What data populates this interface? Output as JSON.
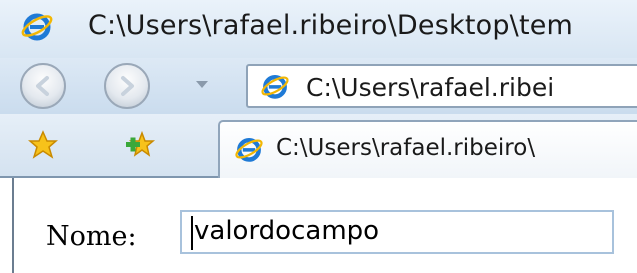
{
  "window": {
    "title": "C:\\Users\\rafael.ribeiro\\Desktop\\tem"
  },
  "navbar": {
    "address": "C:\\Users\\rafael.ribei"
  },
  "tabbar": {
    "tab_title": "C:\\Users\\rafael.ribeiro\\"
  },
  "form": {
    "label": "Nome:",
    "value": "valordocampo"
  },
  "icons": {
    "browser": "internet-explorer-icon",
    "back": "back-arrow-icon",
    "forward": "forward-arrow-icon",
    "favorites": "favorites-star-icon",
    "add_favorite": "add-favorite-icon"
  },
  "colors": {
    "chrome": "#d8e6f3",
    "input_border": "#a8c2dc"
  }
}
